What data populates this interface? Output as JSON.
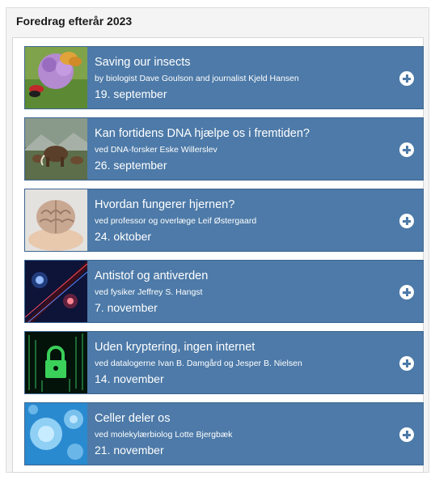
{
  "header": {
    "title": "Foredrag efterår 2023"
  },
  "lectures": [
    {
      "title": "Saving our insects",
      "speaker": "by biologist Dave Goulson and journalist Kjeld Hansen",
      "date": "19. september",
      "thumb": "butterfly"
    },
    {
      "title": "Kan fortidens DNA hjælpe os i fremtiden?",
      "speaker": "ved DNA-forsker Eske Willerslev",
      "date": "26. september",
      "thumb": "mammoths"
    },
    {
      "title": "Hvordan fungerer hjernen?",
      "speaker": "ved professor og overlæge Leif Østergaard",
      "date": "24. oktober",
      "thumb": "brain"
    },
    {
      "title": "Antistof og antiverden",
      "speaker": "ved fysiker Jeffrey S. Hangst",
      "date": "7. november",
      "thumb": "particles"
    },
    {
      "title": "Uden kryptering, ingen internet",
      "speaker": "ved datalogerne Ivan B. Damgård og Jesper B. Nielsen",
      "date": "14. november",
      "thumb": "lock"
    },
    {
      "title": "Celler deler os",
      "speaker": "ved molekylærbiolog Lotte Bjergbæk",
      "date": "21. november",
      "thumb": "cells"
    }
  ],
  "colors": {
    "card": "#4d7aa8",
    "border": "#3c6590",
    "text": "#ffffff"
  }
}
